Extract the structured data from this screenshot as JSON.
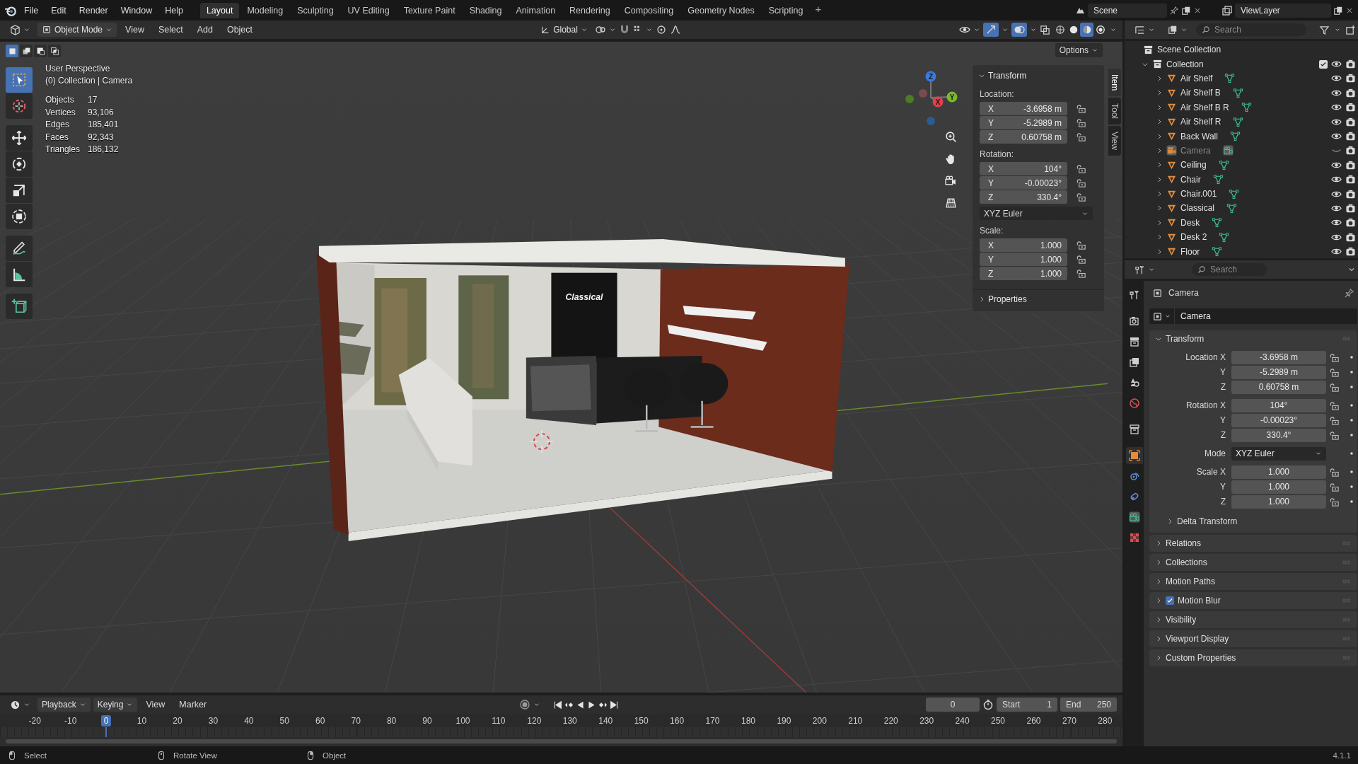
{
  "topbar": {
    "menus": [
      "File",
      "Edit",
      "Render",
      "Window",
      "Help"
    ],
    "workspaces": [
      {
        "label": "Layout",
        "selected": true
      },
      {
        "label": "Modeling",
        "selected": false
      },
      {
        "label": "Sculpting",
        "selected": false
      },
      {
        "label": "UV Editing",
        "selected": false
      },
      {
        "label": "Texture Paint",
        "selected": false
      },
      {
        "label": "Shading",
        "selected": false
      },
      {
        "label": "Animation",
        "selected": false
      },
      {
        "label": "Rendering",
        "selected": false
      },
      {
        "label": "Compositing",
        "selected": false
      },
      {
        "label": "Geometry Nodes",
        "selected": false
      },
      {
        "label": "Scripting",
        "selected": false
      }
    ],
    "add_workspace": "+",
    "scene": "Scene",
    "view_layer": "ViewLayer"
  },
  "viewport_header": {
    "mode": "Object Mode",
    "menus": [
      "View",
      "Select",
      "Add",
      "Object"
    ],
    "orientation": "Global",
    "options": "Options",
    "shading": [
      {
        "kind": "wireframe",
        "selected": false
      },
      {
        "kind": "solid",
        "selected": false
      },
      {
        "kind": "material",
        "selected": true
      },
      {
        "kind": "rendered",
        "selected": false
      }
    ],
    "select_modes": [
      {
        "kind": "new",
        "selected": true
      },
      {
        "kind": "extend",
        "selected": false
      },
      {
        "kind": "subtract",
        "selected": false
      },
      {
        "kind": "intersect",
        "selected": false
      }
    ]
  },
  "viewport": {
    "view_name": "User Perspective",
    "context": "(0) Collection | Camera",
    "stats": [
      {
        "label": "Objects",
        "value": "17"
      },
      {
        "label": "Vertices",
        "value": "93,106"
      },
      {
        "label": "Edges",
        "value": "185,401"
      },
      {
        "label": "Faces",
        "value": "92,343"
      },
      {
        "label": "Triangles",
        "value": "186,132"
      }
    ],
    "tools": [
      {
        "kind": "select_box",
        "selected": true
      },
      {
        "kind": "cursor",
        "selected": false
      },
      {
        "kind": "move",
        "selected": false
      },
      {
        "kind": "rotate",
        "selected": false
      },
      {
        "kind": "scale",
        "selected": false
      },
      {
        "kind": "transform",
        "selected": false
      },
      {
        "kind": "annotate",
        "selected": false
      },
      {
        "kind": "measure",
        "selected": false
      },
      {
        "kind": "add_cube",
        "selected": false
      }
    ],
    "gizmo": {
      "x": "X",
      "y": "Y",
      "z": "Z"
    },
    "scene_sign": "Classical"
  },
  "sidebar": {
    "tabs": [
      {
        "label": "Item",
        "selected": true
      },
      {
        "label": "Tool",
        "selected": false
      },
      {
        "label": "View",
        "selected": false
      }
    ],
    "transform": {
      "title": "Transform",
      "location_label": "Location:",
      "location": [
        {
          "axis": "X",
          "value": "-3.6958 m"
        },
        {
          "axis": "Y",
          "value": "-5.2989 m"
        },
        {
          "axis": "Z",
          "value": "0.60758 m"
        }
      ],
      "rotation_label": "Rotation:",
      "rotation": [
        {
          "axis": "X",
          "value": "104°"
        },
        {
          "axis": "Y",
          "value": "-0.00023°"
        },
        {
          "axis": "Z",
          "value": "330.4°"
        }
      ],
      "rotation_mode": "XYZ Euler",
      "scale_label": "Scale:",
      "scale": [
        {
          "axis": "X",
          "value": "1.000"
        },
        {
          "axis": "Y",
          "value": "1.000"
        },
        {
          "axis": "Z",
          "value": "1.000"
        }
      ]
    },
    "properties_panel": "Properties"
  },
  "outliner": {
    "search_placeholder": "Search",
    "root": "Scene Collection",
    "collection": {
      "name": "Collection",
      "checked": true,
      "expanded": true,
      "children": [
        {
          "name": "Air Shelf",
          "kind": "mesh",
          "visible": true
        },
        {
          "name": "Air Shelf B",
          "kind": "mesh",
          "visible": true
        },
        {
          "name": "Air Shelf B R",
          "kind": "mesh",
          "visible": true
        },
        {
          "name": "Air Shelf R",
          "kind": "mesh",
          "visible": true
        },
        {
          "name": "Back Wall",
          "kind": "mesh",
          "visible": true
        },
        {
          "name": "Camera",
          "kind": "camera",
          "visible": false
        },
        {
          "name": "Ceiling",
          "kind": "mesh",
          "visible": true
        },
        {
          "name": "Chair",
          "kind": "mesh",
          "visible": true
        },
        {
          "name": "Chair.001",
          "kind": "mesh",
          "visible": true
        },
        {
          "name": "Classical",
          "kind": "mesh",
          "visible": true
        },
        {
          "name": "Desk",
          "kind": "mesh",
          "visible": true
        },
        {
          "name": "Desk 2",
          "kind": "mesh",
          "visible": true
        },
        {
          "name": "Floor",
          "kind": "mesh",
          "visible": true
        }
      ]
    }
  },
  "properties": {
    "search_placeholder": "Search",
    "tabs": [
      {
        "kind": "tool",
        "selected": false
      },
      {
        "kind": "render",
        "selected": false
      },
      {
        "kind": "output",
        "selected": false
      },
      {
        "kind": "view_layer",
        "selected": false
      },
      {
        "kind": "scene",
        "selected": false
      },
      {
        "kind": "world",
        "selected": false
      },
      {
        "kind": "collection",
        "selected": false
      },
      {
        "kind": "object",
        "selected": true
      },
      {
        "kind": "physics",
        "selected": false
      },
      {
        "kind": "constraints",
        "selected": false
      },
      {
        "kind": "camera_data",
        "selected": false
      },
      {
        "kind": "texture",
        "selected": false
      }
    ],
    "object_name": "Camera",
    "datablock": "Camera",
    "transform": {
      "title": "Transform",
      "expanded": true,
      "rows": [
        {
          "label": "Location X",
          "value": "-3.6958 m",
          "kind": "number"
        },
        {
          "label": "Y",
          "value": "-5.2989 m",
          "kind": "number"
        },
        {
          "label": "Z",
          "value": "0.60758 m",
          "kind": "number"
        },
        {
          "label": "Rotation X",
          "value": "104°",
          "kind": "number"
        },
        {
          "label": "Y",
          "value": "-0.00023°",
          "kind": "number"
        },
        {
          "label": "Z",
          "value": "330.4°",
          "kind": "number"
        },
        {
          "label": "Mode",
          "value": "XYZ Euler",
          "kind": "dropdown"
        },
        {
          "label": "Scale X",
          "value": "1.000",
          "kind": "number"
        },
        {
          "label": "Y",
          "value": "1.000",
          "kind": "number"
        },
        {
          "label": "Z",
          "value": "1.000",
          "kind": "number"
        }
      ],
      "subpanel": "Delta Transform"
    },
    "panels": [
      {
        "title": "Relations",
        "kind": "plain"
      },
      {
        "title": "Collections",
        "kind": "plain"
      },
      {
        "title": "Motion Paths",
        "kind": "plain"
      },
      {
        "title": "Motion Blur",
        "kind": "toggle",
        "checked": true
      },
      {
        "title": "Visibility",
        "kind": "plain"
      },
      {
        "title": "Viewport Display",
        "kind": "plain"
      },
      {
        "title": "Custom Properties",
        "kind": "plain"
      }
    ]
  },
  "timeline": {
    "menus": [
      {
        "label": "Playback",
        "kind": "dropdown"
      },
      {
        "label": "Keying",
        "kind": "dropdown"
      },
      {
        "label": "View",
        "kind": "menu"
      },
      {
        "label": "Marker",
        "kind": "menu"
      }
    ],
    "current_frame": "0",
    "start_label": "Start",
    "start": "1",
    "end_label": "End",
    "end": "250",
    "ruler": [
      {
        "label": "-20",
        "selected": false
      },
      {
        "label": "-10",
        "selected": false
      },
      {
        "label": "0",
        "selected": true
      },
      {
        "label": "10",
        "selected": false
      },
      {
        "label": "20",
        "selected": false
      },
      {
        "label": "30",
        "selected": false
      },
      {
        "label": "40",
        "selected": false
      },
      {
        "label": "50",
        "selected": false
      },
      {
        "label": "60",
        "selected": false
      },
      {
        "label": "70",
        "selected": false
      },
      {
        "label": "80",
        "selected": false
      },
      {
        "label": "90",
        "selected": false
      },
      {
        "label": "100",
        "selected": false
      },
      {
        "label": "110",
        "selected": false
      },
      {
        "label": "120",
        "selected": false
      },
      {
        "label": "130",
        "selected": false
      },
      {
        "label": "140",
        "selected": false
      },
      {
        "label": "150",
        "selected": false
      },
      {
        "label": "160",
        "selected": false
      },
      {
        "label": "170",
        "selected": false
      },
      {
        "label": "180",
        "selected": false
      },
      {
        "label": "190",
        "selected": false
      },
      {
        "label": "200",
        "selected": false
      },
      {
        "label": "210",
        "selected": false
      },
      {
        "label": "220",
        "selected": false
      },
      {
        "label": "230",
        "selected": false
      },
      {
        "label": "240",
        "selected": false
      },
      {
        "label": "250",
        "selected": false
      },
      {
        "label": "260",
        "selected": false
      },
      {
        "label": "270",
        "selected": false
      },
      {
        "label": "280",
        "selected": false
      }
    ]
  },
  "status_bar": {
    "hints": [
      "Select",
      "Rotate View",
      "Object"
    ],
    "version": "4.1.1"
  }
}
